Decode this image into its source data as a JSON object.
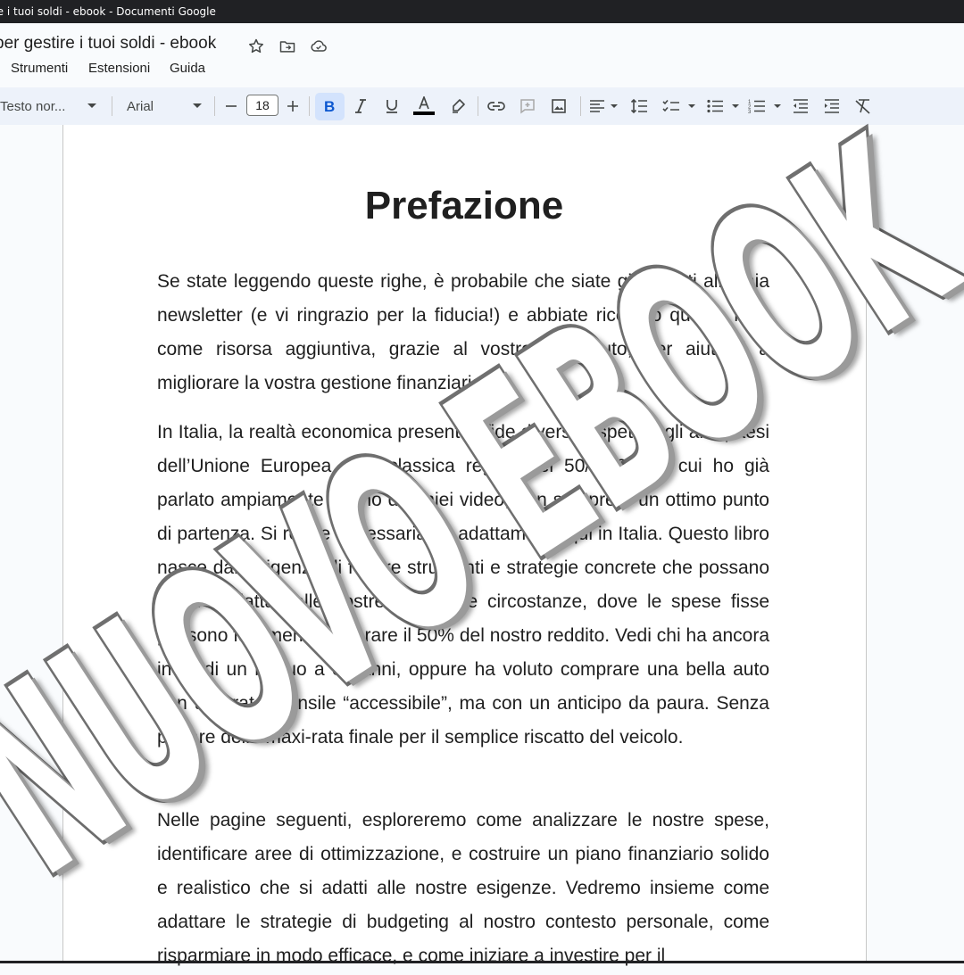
{
  "window": {
    "title": "re i tuoi soldi - ebook - Documenti Google"
  },
  "doc": {
    "title": "per gestire i tuoi soldi - ebook",
    "header_icons": [
      "star-icon",
      "move-folder-icon",
      "cloud-saved-icon"
    ]
  },
  "menu": {
    "items": [
      "Strumenti",
      "Estensioni",
      "Guida"
    ]
  },
  "toolbar": {
    "style_label": "Testo nor...",
    "font_label": "Arial",
    "font_size": "18",
    "text_color": "#000000",
    "bold_active": true,
    "icons": [
      "decrease-size-icon",
      "increase-size-icon",
      "bold-icon",
      "italic-icon",
      "underline-icon",
      "text-color-icon",
      "highlight-icon",
      "link-icon",
      "add-comment-icon",
      "insert-image-icon",
      "align-icon",
      "line-spacing-icon",
      "checklist-icon",
      "bulleted-list-icon",
      "numbered-list-icon",
      "decrease-indent-icon",
      "increase-indent-icon",
      "clear-formatting-icon"
    ]
  },
  "page": {
    "heading": "Prefazione",
    "paragraphs": [
      "Se state leggendo queste righe, è probabile che siate già iscritti alla mia newsletter (e vi ringrazio per la fiducia!) e abbiate ricevuto questo libro come risorsa aggiuntiva, grazie al vostro contributo, per aiutarvi a migliorare la vostra gestione finanziaria.",
      "In Italia, la realtà economica presenta sfide diverse rispetto agli altri paesi dell’Unione Europea e la classica regola del 50/30/20, di cui ho già parlato ampiamente in uno dei miei video, non sempre è un ottimo punto di partenza. Si rende necessaria un adattamento qui in Italia. Questo libro nasce dall’esigenza di fornire strumenti e strategie concrete che possano essere adattati alle nostre specifiche circostanze, dove le spese fisse possono facilmente superare il 50% del nostro reddito. Vedi chi ha ancora in piedi un mutuo a 30 anni, oppure ha voluto comprare una bella auto con una rata mensile “accessibile”, ma con un anticipo da paura. Senza parlare della maxi-rata finale per il semplice riscatto del veicolo.",
      "Nelle pagine seguenti, esploreremo come analizzare le nostre spese, identificare aree di ottimizzazione, e costruire un piano finanziario solido e realistico che si adatti alle nostre esigenze. Vedremo insieme come adattare le strategie di budgeting al nostro contesto personale, come risparmiare in modo efficace, e come iniziare a investire per il"
    ]
  },
  "watermark": {
    "text": "NUOVO EBOOK"
  }
}
